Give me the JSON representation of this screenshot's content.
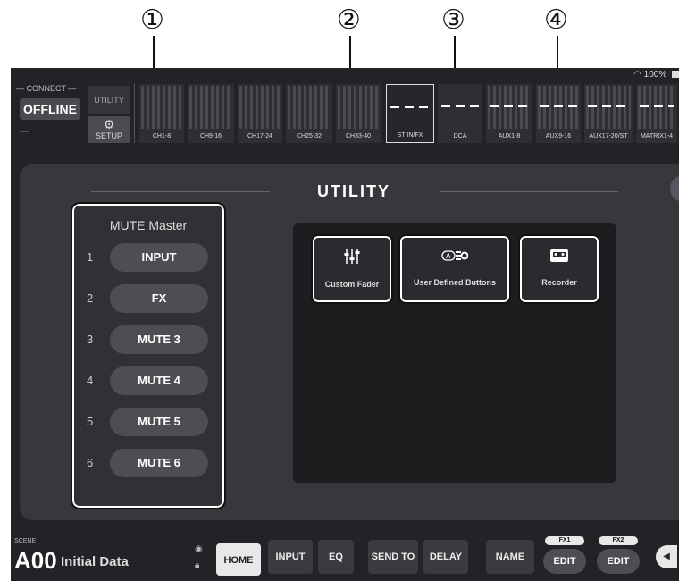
{
  "callouts": [
    "①",
    "②",
    "③",
    "④"
  ],
  "status": {
    "wifi_icon": "wifi-icon",
    "battery": "100%"
  },
  "connect": {
    "label": "— CONNECT —",
    "status": "OFFLINE",
    "sub": "---"
  },
  "top": {
    "utility": "UTILITY",
    "setup": "SETUP"
  },
  "banks": [
    "CH1-8",
    "CH9-16",
    "CH17-24",
    "CH25-32",
    "CH33-40",
    "ST IN/FX",
    "DCA",
    "AUX1-8",
    "AUX9-16",
    "AUX17-20/ST",
    "MATRIX1-4"
  ],
  "panel": {
    "title": "UTILITY",
    "close": "✕",
    "mute_master": {
      "title": "MUTE Master",
      "items": [
        {
          "num": "1",
          "label": "INPUT"
        },
        {
          "num": "2",
          "label": "FX"
        },
        {
          "num": "3",
          "label": "MUTE 3"
        },
        {
          "num": "4",
          "label": "MUTE 4"
        },
        {
          "num": "5",
          "label": "MUTE 5"
        },
        {
          "num": "6",
          "label": "MUTE 6"
        }
      ]
    },
    "functions": [
      {
        "label": "Custom Fader",
        "icon": "faders-icon"
      },
      {
        "label": "User Defined Buttons",
        "icon": "user-defined-buttons-icon"
      },
      {
        "label": "Recorder",
        "icon": "cassette-icon"
      }
    ]
  },
  "bottom": {
    "scene_label": "SCENE",
    "scene_number": "A00",
    "scene_name": "Initial Data",
    "nav": [
      "HOME",
      "INPUT",
      "EQ",
      "SEND TO",
      "DELAY",
      "NAME"
    ],
    "fx": [
      {
        "tag": "FX1",
        "edit": "EDIT"
      },
      {
        "tag": "FX2",
        "edit": "EDIT"
      }
    ]
  },
  "colors": {
    "background": "#222326",
    "panel": "#37383c",
    "button": "#4d4e52",
    "active": "#e8e8e8"
  }
}
